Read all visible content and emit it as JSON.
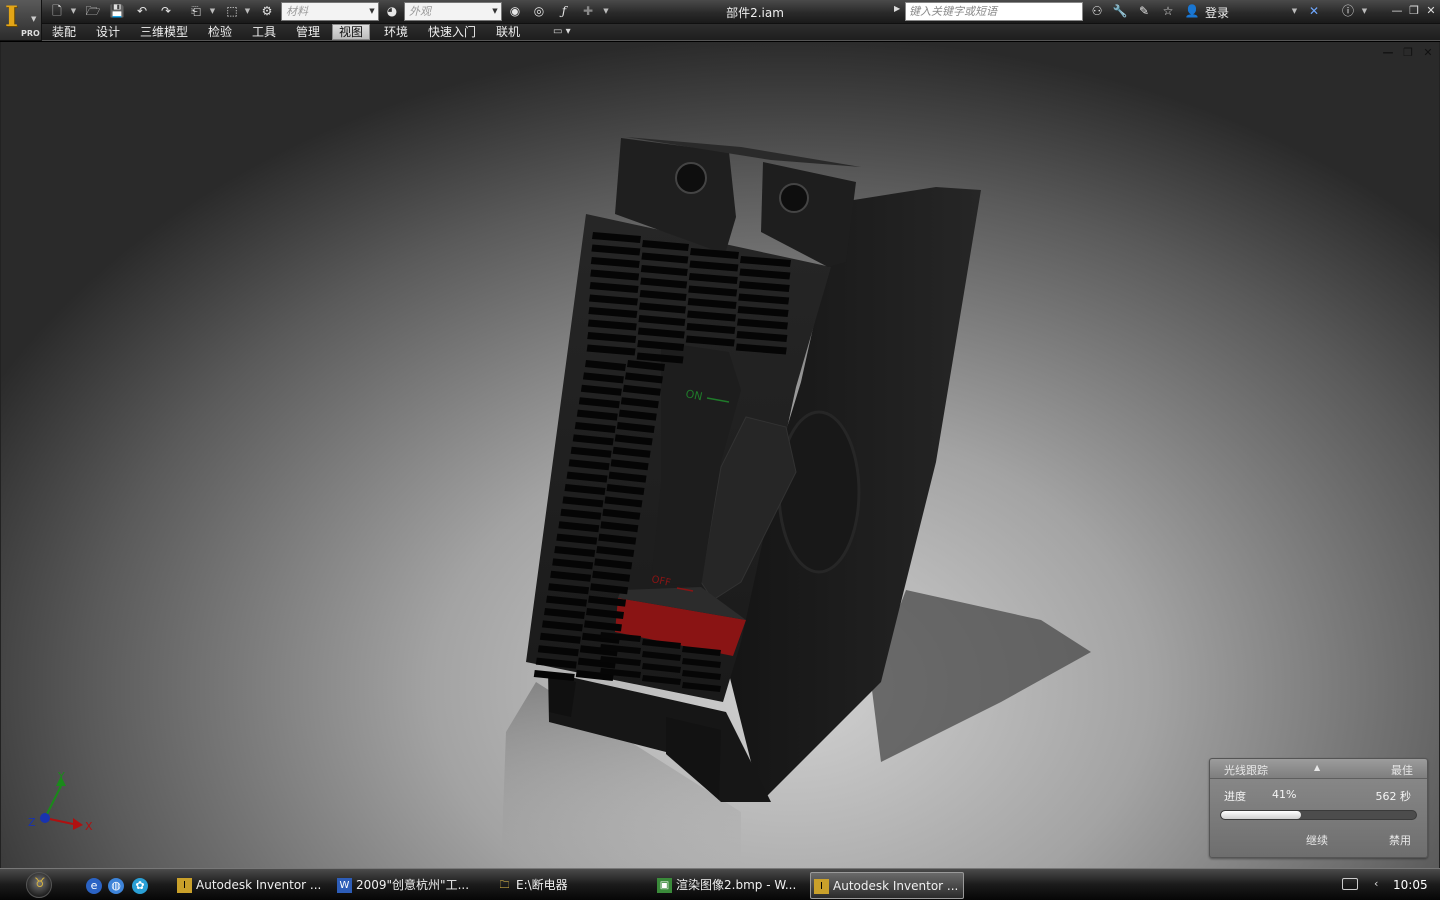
{
  "app": {
    "badge": "PRO",
    "document_title": "部件2.iam",
    "material_placeholder": "材料",
    "appearance_placeholder": "外观",
    "search_placeholder": "键入关键字或短语",
    "login_label": "登录"
  },
  "ribbon_tabs": [
    {
      "label": "装配",
      "active": false
    },
    {
      "label": "设计",
      "active": false
    },
    {
      "label": "三维模型",
      "active": false
    },
    {
      "label": "检验",
      "active": false
    },
    {
      "label": "工具",
      "active": false
    },
    {
      "label": "管理",
      "active": false
    },
    {
      "label": "视图",
      "active": true
    },
    {
      "label": "环境",
      "active": false
    },
    {
      "label": "快速入门",
      "active": false
    },
    {
      "label": "联机",
      "active": false
    }
  ],
  "model": {
    "switch_on_label": "ON",
    "switch_off_label": "OFF",
    "body_color": "#1c1c1c",
    "switch_stripe_color": "#8a1414",
    "on_text_color": "#1f7a2a"
  },
  "axis_triad": {
    "x": "X",
    "y": "Y",
    "z": "Z"
  },
  "ray_tracing": {
    "title": "光线跟踪",
    "quality": "最佳",
    "progress_label": "进度",
    "progress_value": "41%",
    "progress_fraction": 0.41,
    "time": "562 秒",
    "continue_label": "继续",
    "disable_label": "禁用"
  },
  "taskbar": {
    "tasks": [
      {
        "label": "Autodesk Inventor ...",
        "icon": "inventor-icon",
        "active": false
      },
      {
        "label": "2009\"创意杭州\"工...",
        "icon": "word-icon",
        "active": false
      },
      {
        "label": "E:\\断电器",
        "icon": "folder-icon",
        "active": false
      },
      {
        "label": "渲染图像2.bmp - W...",
        "icon": "image-icon",
        "active": false
      },
      {
        "label": "Autodesk Inventor ...",
        "icon": "inventor-icon",
        "active": true
      }
    ],
    "clock": "10:05"
  }
}
